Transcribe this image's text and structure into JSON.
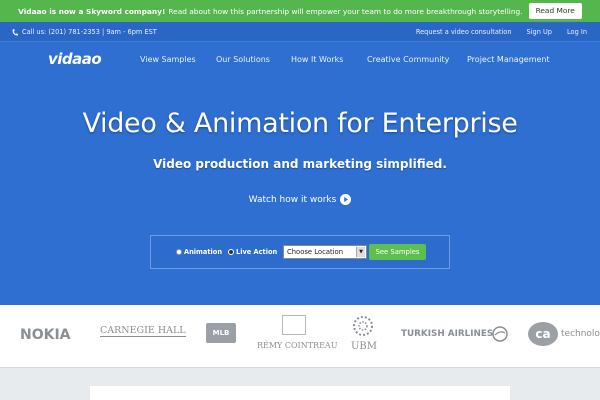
{
  "banner": {
    "bold_text": "Vidaao is now a Skyword company!",
    "text": "Read about how this partnership will empower your team to do more breakthrough storytelling.",
    "button": "Read More"
  },
  "topbar": {
    "call": "Call us: (201) 781-2353 | 9am - 6pm EST",
    "links": [
      "Request a video consultation",
      "Sign Up",
      "Log In"
    ]
  },
  "brand": {
    "logo": "vidaao"
  },
  "nav": [
    "View Samples",
    "Our Solutions",
    "How It Works",
    "Creative Community",
    "Project Management"
  ],
  "hero": {
    "headline": "Video & Animation for Enterprise",
    "subhead": "Video production and marketing simplified.",
    "watch": "Watch how it works"
  },
  "search": {
    "radio_animation": "Animation",
    "radio_live": "Live Action",
    "select_value": "Choose Location",
    "button": "See Samples"
  },
  "clients": [
    "NOKIA",
    "CARNEGIE HALL",
    "MLB",
    "RÉMY COINTREAU",
    "UBM",
    "TURKISH AIRLINES",
    "technologies"
  ],
  "colors": {
    "hero": "#2e6fd1",
    "banner": "#55b64e",
    "button_green": "#5cbf4f"
  }
}
